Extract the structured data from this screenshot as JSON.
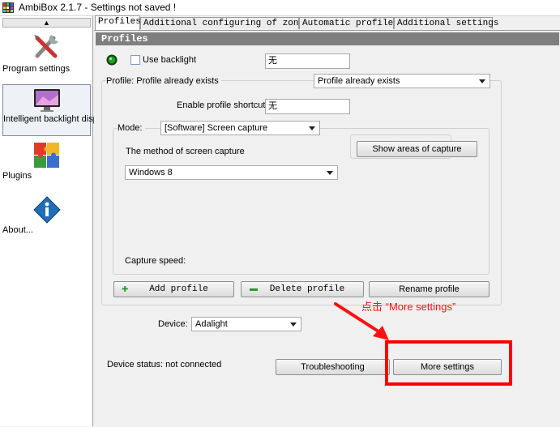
{
  "window": {
    "title": "AmbiBox 2.1.7 - Settings not saved !"
  },
  "sidebar": {
    "scroll_up": "▲",
    "items": [
      {
        "label": "Program settings",
        "icon": "tools-icon"
      },
      {
        "label": "Intelligent backlight display",
        "icon": "monitor-icon"
      },
      {
        "label": "Plugins",
        "icon": "puzzle-icon"
      },
      {
        "label": "About...",
        "icon": "info-icon"
      }
    ]
  },
  "tabs": [
    {
      "label": "Profiles",
      "active": true
    },
    {
      "label": "Additional configuring of zones"
    },
    {
      "label": "Automatic profiles"
    },
    {
      "label": "Additional settings"
    }
  ],
  "profiles": {
    "header": "Profiles",
    "use_backlight_label": "Use backlight",
    "use_backlight_value": "无",
    "profile_group_label": "Profile: Profile already exists",
    "profile_select": "Profile already exists",
    "enable_shortcut_label": "Enable profile shortcut:",
    "enable_shortcut_value": "无",
    "mode_label": "Mode:",
    "mode_select": "[Software] Screen capture",
    "capture_method_label": "The method of screen capture",
    "capture_method_select": "Windows 8",
    "show_areas_button": "Show areas of capture",
    "capture_speed_label": "Capture speed:",
    "add_profile": "Add profile",
    "delete_profile": "Delete profile",
    "rename_profile": "Rename profile",
    "device_label": "Device:",
    "device_select": "Adalight",
    "device_status": "Device status: not connected",
    "troubleshooting": "Troubleshooting",
    "more_settings": "More settings"
  },
  "annotation": {
    "text": "点击 “More settings”",
    "color": "#ff0000"
  }
}
